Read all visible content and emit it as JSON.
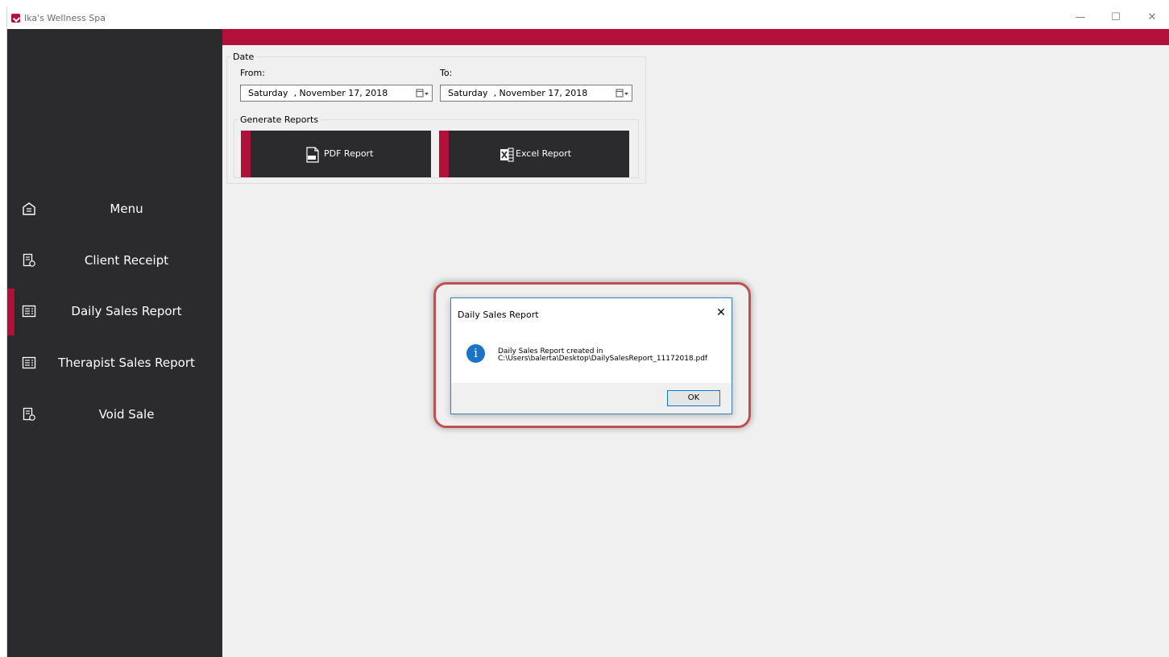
{
  "window": {
    "title": "Ika's Wellness Spa",
    "controls": {
      "minimize": "—",
      "maximize": "☐",
      "close": "✕"
    }
  },
  "colors": {
    "accent": "#b0103a",
    "sidebar": "#2b2a2c",
    "background": "#f0f0f0"
  },
  "sidebar": {
    "items": [
      {
        "label": "Menu",
        "icon": "home-icon",
        "active": false
      },
      {
        "label": "Client Receipt",
        "icon": "receipt-icon",
        "active": false
      },
      {
        "label": "Daily Sales Report",
        "icon": "report-icon",
        "active": true
      },
      {
        "label": "Therapist Sales Report",
        "icon": "report-icon",
        "active": false
      },
      {
        "label": "Void Sale",
        "icon": "receipt-icon",
        "active": false
      }
    ]
  },
  "date_group": {
    "legend": "Date",
    "from_label": "From:",
    "to_label": "To:",
    "from_value": "Saturday  , November 17, 2018",
    "to_value": "Saturday  , November 17, 2018"
  },
  "reports_group": {
    "legend": "Generate Reports",
    "pdf_label": "PDF Report",
    "excel_label": "Excel Report"
  },
  "dialog": {
    "title": "Daily Sales Report",
    "close": "✕",
    "message_line1": "Daily Sales Report created in",
    "message_line2": "C:\\Users\\balerta\\Desktop\\DailySalesReport_11172018.pdf",
    "info_glyph": "i",
    "ok_label": "OK"
  }
}
